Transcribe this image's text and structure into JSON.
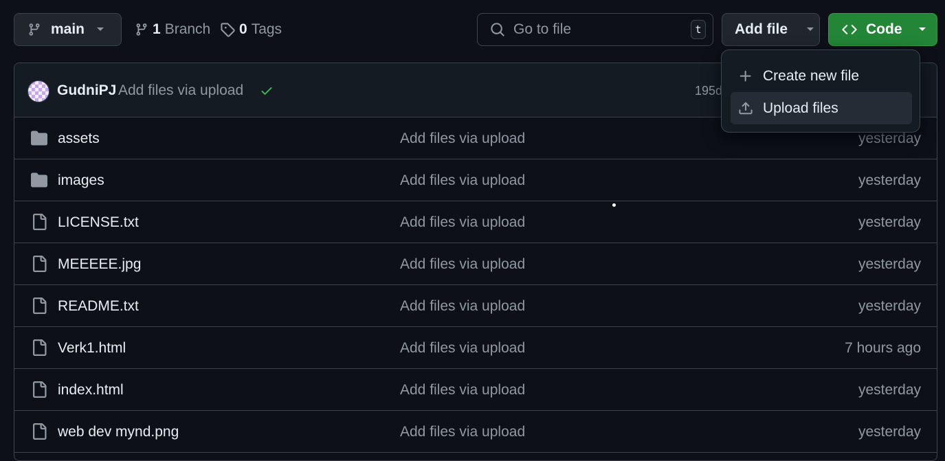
{
  "toolbar": {
    "branch": "main",
    "branches_count": "1",
    "branches_label": "Branch",
    "tags_count": "0",
    "tags_label": "Tags",
    "search_placeholder": "Go to file",
    "search_shortcut": "t",
    "add_file_label": "Add file",
    "code_label": "Code"
  },
  "dropdown": {
    "items": [
      {
        "label": "Create new file",
        "icon": "plus-icon"
      },
      {
        "label": "Upload files",
        "icon": "upload-icon"
      }
    ]
  },
  "latest_commit": {
    "author": "GudniPJ",
    "message": "Add files via upload",
    "time": "195d"
  },
  "files": [
    {
      "name": "assets",
      "type": "folder",
      "message": "Add files via upload",
      "time": "yesterday"
    },
    {
      "name": "images",
      "type": "folder",
      "message": "Add files via upload",
      "time": "yesterday"
    },
    {
      "name": "LICENSE.txt",
      "type": "file",
      "message": "Add files via upload",
      "time": "yesterday"
    },
    {
      "name": "MEEEEE.jpg",
      "type": "file",
      "message": "Add files via upload",
      "time": "yesterday"
    },
    {
      "name": "README.txt",
      "type": "file",
      "message": "Add files via upload",
      "time": "yesterday"
    },
    {
      "name": "Verk1.html",
      "type": "file",
      "message": "Add files via upload",
      "time": "7 hours ago"
    },
    {
      "name": "index.html",
      "type": "file",
      "message": "Add files via upload",
      "time": "yesterday"
    },
    {
      "name": "web dev mynd.png",
      "type": "file",
      "message": "Add files via upload",
      "time": "yesterday"
    }
  ],
  "colors": {
    "background": "#0d1117",
    "border": "#3d444d",
    "primary_green": "#238636",
    "muted_text": "#9198a1",
    "check_green": "#3fb950"
  }
}
